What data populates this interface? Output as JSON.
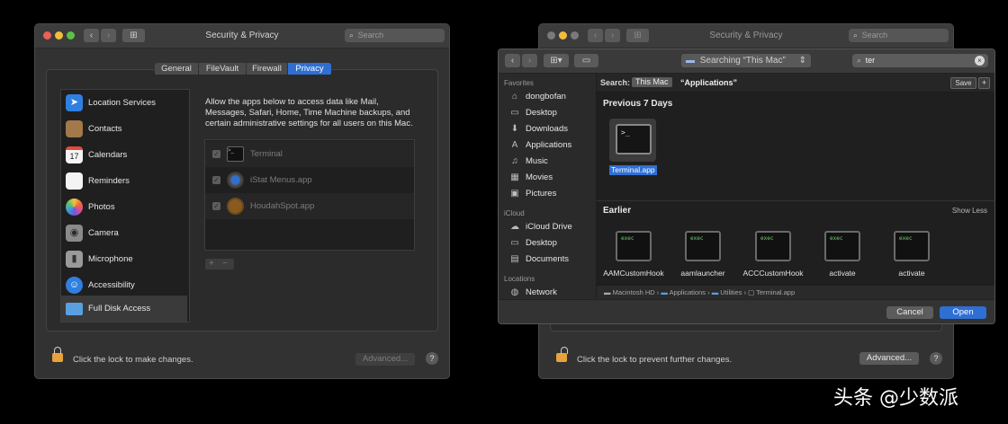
{
  "left_window": {
    "title": "Security & Privacy",
    "search_placeholder": "Search",
    "grid_icon": "⊞",
    "tabs": [
      {
        "label": "General"
      },
      {
        "label": "FileVault"
      },
      {
        "label": "Firewall"
      },
      {
        "label": "Privacy",
        "selected": true
      }
    ],
    "sidebar": [
      {
        "label": "Location Services",
        "icon": "location-arrow-icon",
        "color": "#2f7fe0"
      },
      {
        "label": "Contacts",
        "icon": "contacts-book-icon",
        "color": "#a3784a"
      },
      {
        "label": "Calendars",
        "icon": "calendar-icon",
        "color": "#f4f4f4",
        "glyph": "17"
      },
      {
        "label": "Reminders",
        "icon": "reminders-list-icon",
        "color": "#f4f4f4"
      },
      {
        "label": "Photos",
        "icon": "photos-flower-icon",
        "color": "#e8b34a"
      },
      {
        "label": "Camera",
        "icon": "camera-icon",
        "color": "#8a8a8a"
      },
      {
        "label": "Microphone",
        "icon": "microphone-icon",
        "color": "#9a9a9a"
      },
      {
        "label": "Accessibility",
        "icon": "accessibility-icon",
        "color": "#2f7fe0"
      },
      {
        "label": "Full Disk Access",
        "icon": "folder-icon",
        "color": "#5aa0e0",
        "selected": true
      }
    ],
    "description": "Allow the apps below to access data like Mail, Messages, Safari, Home, Time Machine backups, and certain administrative settings for all users on this Mac.",
    "apps": [
      {
        "name": "Terminal",
        "icon": "terminal-icon",
        "checked": true
      },
      {
        "name": "iStat Menus.app",
        "icon": "istat-menus-icon",
        "checked": true
      },
      {
        "name": "HoudahSpot.app",
        "icon": "houdahspot-icon",
        "checked": true
      }
    ],
    "add_label": "+",
    "remove_label": "−",
    "lock_text": "Click the lock to make changes.",
    "advanced_label": "Advanced...",
    "help_label": "?"
  },
  "right_window": {
    "title": "Security & Privacy",
    "search_placeholder": "Search",
    "lock_text": "Click the lock to prevent further changes.",
    "advanced_label": "Advanced...",
    "help_label": "?"
  },
  "open_panel": {
    "back_label": "‹",
    "forward_label": "›",
    "location_label": "Searching “This Mac”",
    "search_value": "ter",
    "search_scope_prefix": "Search:",
    "scope_this_mac": "This Mac",
    "scope_applications": "“Applications”",
    "save_label": "Save",
    "add_label": "+",
    "sidebar": {
      "favorites_header": "Favorites",
      "favorites": [
        {
          "label": "dongbofan",
          "icon": "home-icon",
          "glyph": "⌂"
        },
        {
          "label": "Desktop",
          "icon": "desktop-icon",
          "glyph": "▭"
        },
        {
          "label": "Downloads",
          "icon": "downloads-icon",
          "glyph": "⬇"
        },
        {
          "label": "Applications",
          "icon": "applications-icon",
          "glyph": "A"
        },
        {
          "label": "Music",
          "icon": "music-note-icon",
          "glyph": "♫"
        },
        {
          "label": "Movies",
          "icon": "movies-icon",
          "glyph": "▦"
        },
        {
          "label": "Pictures",
          "icon": "pictures-icon",
          "glyph": "▣"
        }
      ],
      "icloud_header": "iCloud",
      "icloud": [
        {
          "label": "iCloud Drive",
          "icon": "cloud-icon",
          "glyph": "☁"
        },
        {
          "label": "Desktop",
          "icon": "desktop-icon",
          "glyph": "▭"
        },
        {
          "label": "Documents",
          "icon": "documents-icon",
          "glyph": "▤"
        }
      ],
      "locations_header": "Locations",
      "locations": [
        {
          "label": "Network",
          "icon": "network-globe-icon",
          "glyph": "◍"
        }
      ]
    },
    "recent_header": "Previous 7 Days",
    "recent_item": {
      "name": "Terminal.app",
      "glyph": ">_"
    },
    "earlier_header": "Earlier",
    "show_less_label": "Show Less",
    "earlier_items": [
      {
        "name": "AAMCustomHook",
        "glyph": "exec"
      },
      {
        "name": "aamlauncher",
        "glyph": "exec"
      },
      {
        "name": "ACCCustomHook",
        "glyph": "exec"
      },
      {
        "name": "activate",
        "glyph": "exec"
      },
      {
        "name": "activate",
        "glyph": "exec"
      }
    ],
    "path": [
      {
        "label": "Macintosh HD"
      },
      {
        "label": "Applications"
      },
      {
        "label": "Utilities"
      },
      {
        "label": "Terminal.app"
      }
    ],
    "path_sep": "›",
    "cancel_label": "Cancel",
    "open_label": "Open"
  },
  "watermark": "头条 @少数派",
  "colors": {
    "accent": "#2f6fd4",
    "background": "#000000",
    "window": "#323232"
  }
}
